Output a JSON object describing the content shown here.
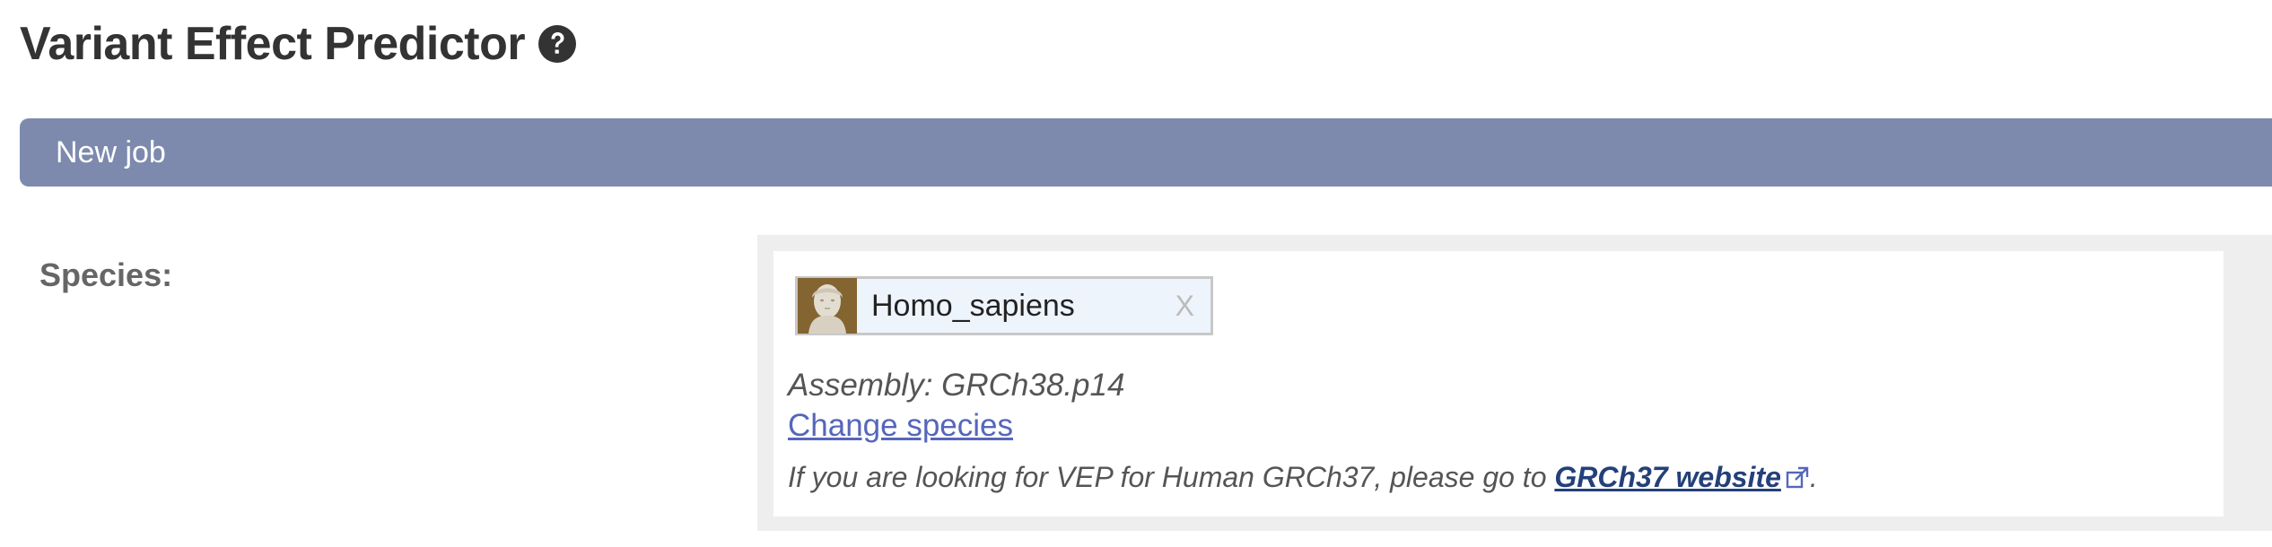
{
  "header": {
    "title": "Variant Effect Predictor",
    "help_icon": "question-circle-icon"
  },
  "job_bar": {
    "label": "New job",
    "color": "#7d8aad"
  },
  "species_section": {
    "label": "Species:",
    "selected_species": {
      "name": "Homo_sapiens",
      "remove_label": "X",
      "thumbnail_icon": "species-thumbnail"
    },
    "assembly": "Assembly: GRCh38.p14",
    "change_link": "Change species",
    "note_prefix": "If you are looking for VEP for Human GRCh37, please go to ",
    "note_link": "GRCh37 website",
    "note_suffix": ".",
    "external_icon": "external-link-icon"
  },
  "colors": {
    "link": "#5566bb",
    "dark_link": "#24407a",
    "panel_bg": "#eeeeee"
  }
}
